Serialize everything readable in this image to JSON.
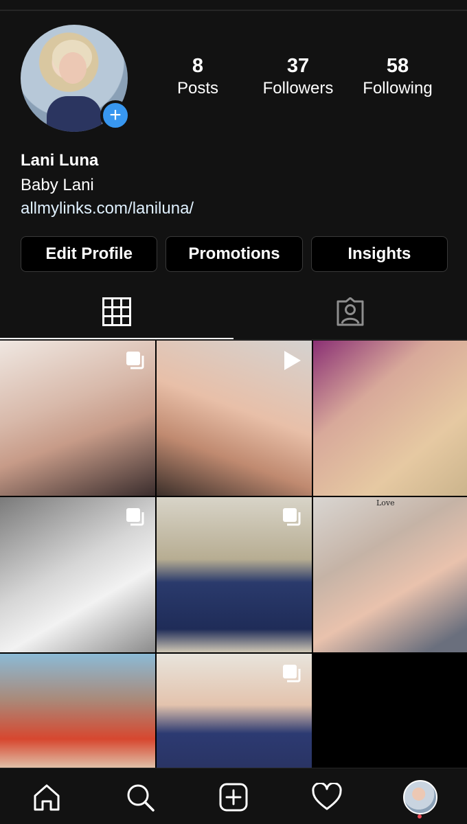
{
  "profile": {
    "name": "Lani Luna",
    "category": "Baby Lani",
    "link": "allmylinks.com/laniluna/",
    "add_badge": "+"
  },
  "stats": {
    "posts": {
      "count": "8",
      "label": "Posts"
    },
    "followers": {
      "count": "37",
      "label": "Followers"
    },
    "following": {
      "count": "58",
      "label": "Following"
    }
  },
  "buttons": {
    "edit": "Edit Profile",
    "promotions": "Promotions",
    "insights": "Insights"
  },
  "tabs": [
    {
      "icon": "grid-icon",
      "active": true
    },
    {
      "icon": "tagged-person-icon",
      "active": false
    }
  ],
  "posts": [
    {
      "type": "carousel",
      "badge_icon": "carousel-icon"
    },
    {
      "type": "video",
      "badge_icon": "play-icon"
    },
    {
      "type": "photo",
      "badge_icon": ""
    },
    {
      "type": "carousel",
      "badge_icon": "carousel-icon"
    },
    {
      "type": "carousel",
      "badge_icon": "carousel-icon"
    },
    {
      "type": "photo",
      "badge_icon": "",
      "overlay_text": "Love"
    },
    {
      "type": "photo",
      "badge_icon": ""
    },
    {
      "type": "carousel",
      "badge_icon": "carousel-icon"
    }
  ],
  "bottom_nav": [
    {
      "icon": "home-icon"
    },
    {
      "icon": "search-icon"
    },
    {
      "icon": "new-post-icon"
    },
    {
      "icon": "heart-icon"
    },
    {
      "icon": "profile-avatar-icon",
      "notification": true
    }
  ],
  "colors": {
    "background": "#121212",
    "accent": "#3897f0",
    "notification": "#ed4956"
  }
}
